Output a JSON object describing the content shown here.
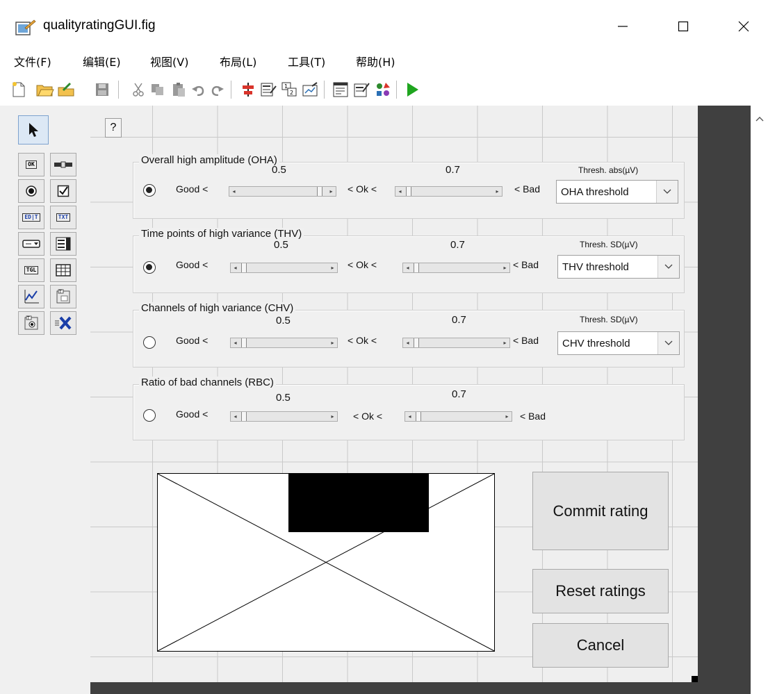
{
  "window": {
    "title": "qualityratingGUI.fig",
    "minimize": "—",
    "maximize": "☐",
    "close": "✕"
  },
  "menu": [
    {
      "label": "文件(F)"
    },
    {
      "label": "编辑(E)"
    },
    {
      "label": "视图(V)"
    },
    {
      "label": "布局(L)"
    },
    {
      "label": "工具(T)"
    },
    {
      "label": "帮助(H)"
    }
  ],
  "help_button": "?",
  "palette_chips": {
    "push": "OK",
    "edit": "ED|T",
    "text": "TXT",
    "toggle": "TGL"
  },
  "panels": [
    {
      "title": "Overall high amplitude (OHA)",
      "selected": true,
      "good": "Good <",
      "ok": "< Ok <",
      "bad": "< Bad",
      "low": "0.5",
      "high": "0.7",
      "thresh_label": "Thresh. abs(µV)",
      "thresh_value": "OHA threshold"
    },
    {
      "title": "Time points of high variance (THV)",
      "selected": true,
      "good": "Good <",
      "ok": "< Ok <",
      "bad": "< Bad",
      "low": "0.5",
      "high": "0.7",
      "thresh_label": "Thresh. SD(µV)",
      "thresh_value": "THV threshold"
    },
    {
      "title": "Channels of high variance (CHV)",
      "selected": false,
      "good": "Good <",
      "ok": "< Ok <",
      "bad": "< Bad",
      "low": "0.5",
      "high": "0.7",
      "thresh_label": "Thresh. SD(µV)",
      "thresh_value": "CHV threshold"
    },
    {
      "title": "Ratio of bad channels (RBC)",
      "selected": false,
      "good": "Good <",
      "ok": "< Ok <",
      "bad": "< Bad",
      "low": "0.5",
      "high": "0.7"
    }
  ],
  "buttons": {
    "commit": "Commit rating",
    "reset": "Reset ratings",
    "cancel": "Cancel"
  },
  "colors": {
    "canvas": "#efefef",
    "grid": "#c9c9c9",
    "dark_frame": "#404040",
    "run_green": "#1fa51f"
  }
}
